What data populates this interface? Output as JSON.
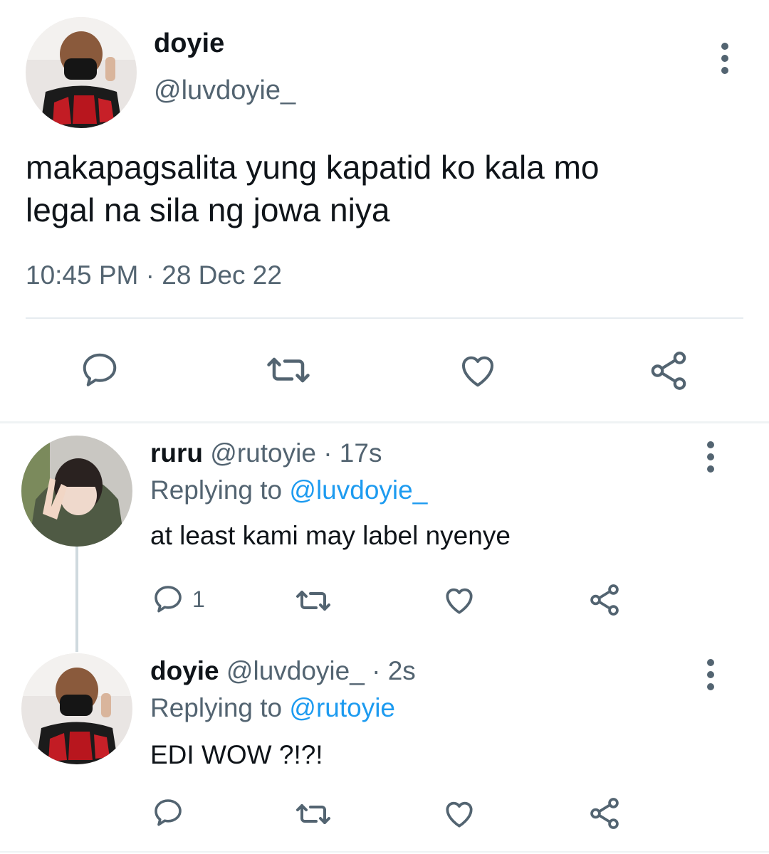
{
  "main_tweet": {
    "display_name": "doyie",
    "handle": "@luvdoyie_",
    "text_line1": "makapagsalita yung kapatid ko kala mo",
    "text_line2": "legal na sila ng jowa niya",
    "timestamp": "10:45 PM · 28 Dec 22",
    "actions": [
      "reply-icon",
      "retweet-icon",
      "like-icon",
      "share-icon"
    ]
  },
  "replies": [
    {
      "display_name": "ruru",
      "handle": "@rutoyie",
      "time": "· 17s",
      "replying_prefix": "Replying to",
      "replying_to": "@luvdoyie_",
      "text": "at least kami may label nyenye",
      "reply_count": "1"
    },
    {
      "display_name": "doyie",
      "handle": "@luvdoyie_",
      "time": "· 2s",
      "replying_prefix": "Replying to",
      "replying_to": "@rutoyie",
      "text": "EDI WOW ?!?!",
      "reply_count": ""
    }
  ],
  "colors": {
    "text": "#0f1419",
    "muted": "#536471",
    "link": "#1d9bf0",
    "divider": "#e6ecf0"
  }
}
